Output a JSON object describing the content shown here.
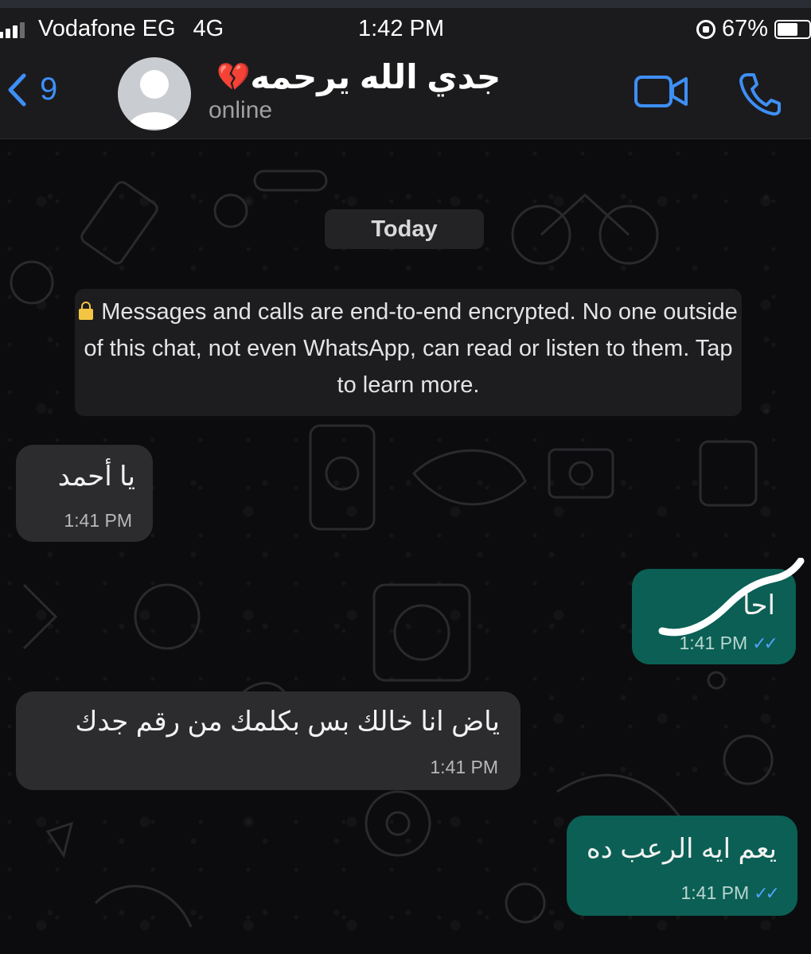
{
  "status_bar": {
    "carrier": "Vodafone EG",
    "network": "4G",
    "time": "1:42 PM",
    "battery": "67%",
    "battery_level": 0.67
  },
  "header": {
    "back_count": "9",
    "contact_name": "جدي الله يرحمه",
    "heart": "💔",
    "status": "online"
  },
  "chat": {
    "date_label": "Today",
    "encryption_notice": "Messages and calls are end-to-end encrypted. No one outside of this chat, not even WhatsApp, can read or listen to them. Tap to learn more.",
    "messages": [
      {
        "direction": "incoming",
        "text": "يا أحمد",
        "time": "1:41 PM"
      },
      {
        "direction": "outgoing",
        "text": "احا",
        "time": "1:41 PM",
        "ticks": "✓✓"
      },
      {
        "direction": "incoming",
        "text": "ياض انا خالك بس بكلمك من رقم جدك",
        "time": "1:41 PM"
      },
      {
        "direction": "outgoing",
        "text": "يعم ايه الرعب ده",
        "time": "1:41 PM",
        "ticks": "✓✓"
      }
    ]
  },
  "colors": {
    "accent": "#3e8ff5",
    "incoming_bubble": "#2c2c2f",
    "outgoing_bubble": "#0b5f54",
    "read_ticks": "#4fa3f7"
  }
}
